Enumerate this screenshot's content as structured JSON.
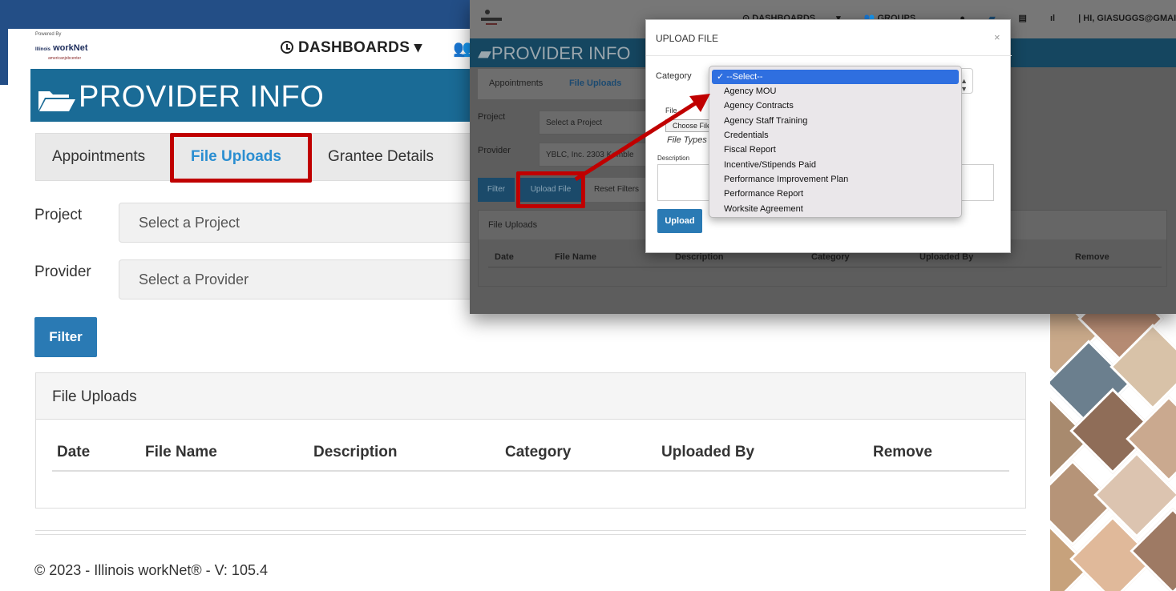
{
  "background_page": {
    "logo": {
      "powered_by": "Powered By",
      "brand": "workNet",
      "brand_prefix": "Illinois",
      "partner": "americanjobcenter"
    },
    "nav": {
      "dashboards": "DASHBOARDS"
    },
    "header": {
      "title": "PROVIDER INFO"
    },
    "tabs": [
      {
        "label": "Appointments"
      },
      {
        "label": "File Uploads",
        "active": true
      },
      {
        "label": "Grantee Details"
      }
    ],
    "filters": {
      "project": {
        "label": "Project",
        "placeholder": "Select a Project"
      },
      "provider": {
        "label": "Provider",
        "placeholder": "Select a Provider"
      },
      "filter_button": "Filter"
    },
    "panel": {
      "title": "File Uploads",
      "columns": [
        "Date",
        "File Name",
        "Description",
        "Category",
        "Uploaded By",
        "Remove"
      ]
    },
    "footer": "© 2023 - Illinois workNet® - V: 105.4"
  },
  "overlay_page": {
    "nav": {
      "dashboards": "DASHBOARDS",
      "groups": "GROUPS",
      "user": "HI, GIASUGGS@GMAIL.COM"
    },
    "header": {
      "title": "PROVIDER INFO"
    },
    "tabs": [
      {
        "label": "Appointments"
      },
      {
        "label": "File Uploads",
        "active": true
      }
    ],
    "filters": {
      "project_label": "Project",
      "project_placeholder": "Select a Project",
      "provider_label": "Provider",
      "provider_value": "YBLC, Inc. 2303 Kemble"
    },
    "buttons": {
      "filter": "Filter",
      "upload_file": "Upload File",
      "reset_filters": "Reset Filters"
    },
    "panel": {
      "title": "File Uploads",
      "columns": [
        "Date",
        "File Name",
        "Description",
        "Category",
        "Uploaded By",
        "Remove"
      ]
    }
  },
  "modal": {
    "title": "UPLOAD FILE",
    "close": "×",
    "category_label": "Category",
    "file_label": "File",
    "choose_file": "Choose File",
    "file_types": "File Types",
    "description_label": "Description",
    "upload_button": "Upload"
  },
  "dropdown": {
    "selected": "--Select--",
    "options": [
      "Agency MOU",
      "Agency Contracts",
      "Agency Staff Training",
      "Credentials",
      "Fiscal Report",
      "Incentive/Stipends Paid",
      "Performance Improvement Plan",
      "Performance Report",
      "Worksite Agreement"
    ]
  },
  "colors": {
    "brand_blue": "#1a6b96",
    "top_band": "#234e86",
    "highlight_red": "#c00000",
    "button_blue": "#2a7ab4",
    "active_tab": "#2a8ed1",
    "dropdown_selected": "#2f6fe0"
  }
}
